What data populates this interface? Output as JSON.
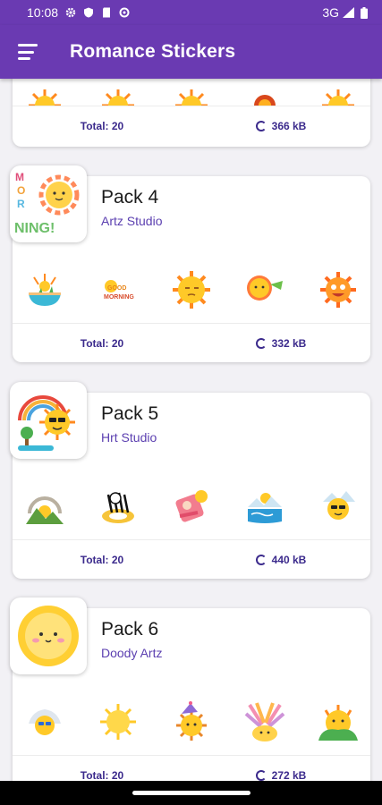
{
  "status_bar": {
    "time": "10:08",
    "network": "3G"
  },
  "app_bar": {
    "title": "Romance Stickers"
  },
  "packs": [
    {
      "name": "",
      "author": "",
      "total": "Total: 20",
      "size": "366 kB"
    },
    {
      "name": "Pack 4",
      "author": "Artz Studio",
      "total": "Total: 20",
      "size": "332 kB",
      "tray_text": "MORNING!"
    },
    {
      "name": "Pack 5",
      "author": "Hrt Studio",
      "total": "Total: 20",
      "size": "440 kB"
    },
    {
      "name": "Pack 6",
      "author": "Doody Artz",
      "total": "Total: 20",
      "size": "272 kB"
    }
  ],
  "colors": {
    "primary": "#6a3ab2",
    "accent_text": "#3b2a8c",
    "sun_yellow": "#ffc928",
    "sun_orange": "#ff8a1f"
  },
  "icons": [
    "settings-icon",
    "shield-icon",
    "sd-card-icon",
    "gear-icon",
    "signal-icon",
    "battery-icon",
    "menu-icon",
    "sun-sticker-icon"
  ]
}
